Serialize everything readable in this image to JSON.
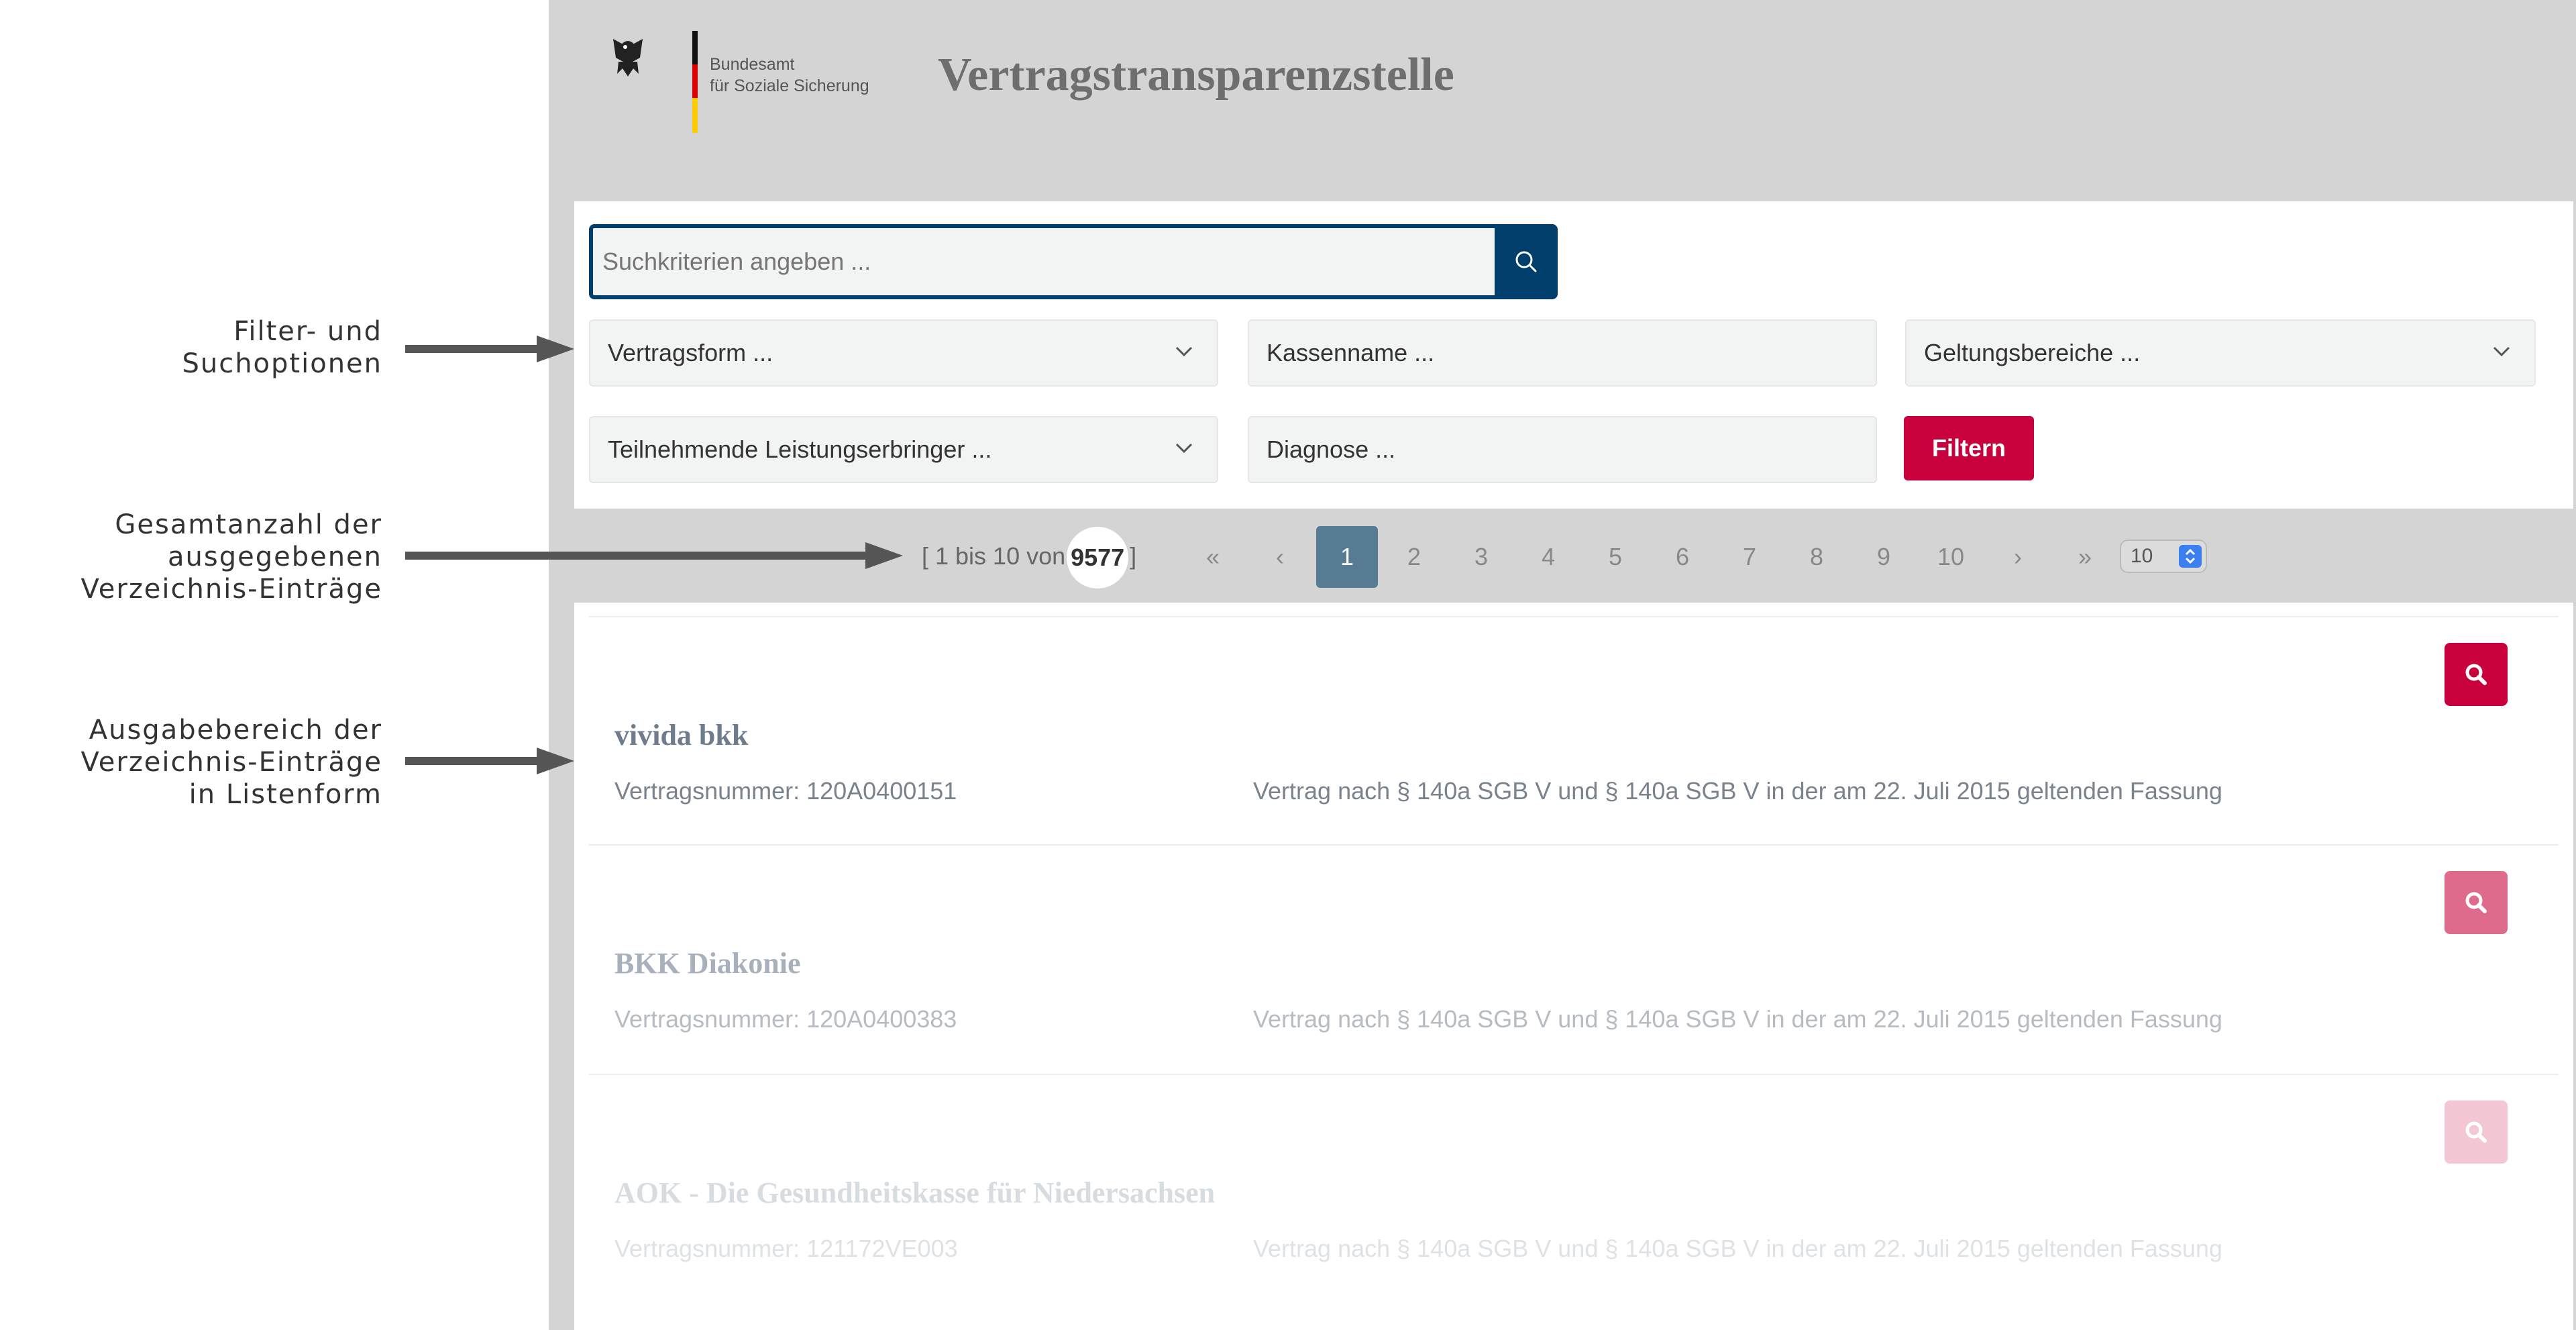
{
  "annotations": {
    "filter": "Filter- und\nSuchoptionen",
    "count": "Gesamtanzahl der\nausgegebenen\nVerzeichnis-Einträge",
    "list": "Ausgabebereich der\nVerzeichnis-Einträge\nin Listenform"
  },
  "header": {
    "logo_text": "Bundesamt\nfür Soziale Sicherung",
    "title": "Vertragstransparenzstelle"
  },
  "search": {
    "placeholder": "Suchkriterien angeben ...",
    "button_icon": "search-icon"
  },
  "filters": {
    "vertragsform": "Vertragsform ...",
    "kassenname": "Kassenname ...",
    "geltungsbereiche": "Geltungsbereiche ...",
    "leistungserbringer": "Teilnehmende Leistungserbringer ...",
    "diagnose": "Diagnose ...",
    "filter_button": "Filtern"
  },
  "pagination": {
    "range_prefix": "[ 1 bis 10 von",
    "total": "9577",
    "range_suffix": "]",
    "first": "«",
    "prev": "‹",
    "pages": [
      "1",
      "2",
      "3",
      "4",
      "5",
      "6",
      "7",
      "8",
      "9",
      "10"
    ],
    "current_page": "1",
    "next": "›",
    "last": "»",
    "page_size": "10"
  },
  "results": [
    {
      "name": "vivida bkk",
      "vertragsnummer": "Vertragsnummer: 120A0400151",
      "vertragstyp": "Vertrag nach § 140a SGB V und § 140a SGB V in der am 22. Juli 2015 geltenden Fassung"
    },
    {
      "name": "BKK Diakonie",
      "vertragsnummer": "Vertragsnummer: 120A0400383",
      "vertragstyp": "Vertrag nach § 140a SGB V und § 140a SGB V in der am 22. Juli 2015 geltenden Fassung"
    },
    {
      "name": "AOK - Die Gesundheitskasse für Niedersachsen",
      "vertragsnummer": "Vertragsnummer: 121172VE003",
      "vertragstyp": "Vertrag nach § 140a SGB V und § 140a SGB V in der am 22. Juli 2015 geltenden Fassung"
    }
  ],
  "colors": {
    "primary_blue": "#003f6b",
    "accent_red": "#c8003c",
    "active_page": "#577b93",
    "app_background": "#d4d4d4"
  }
}
